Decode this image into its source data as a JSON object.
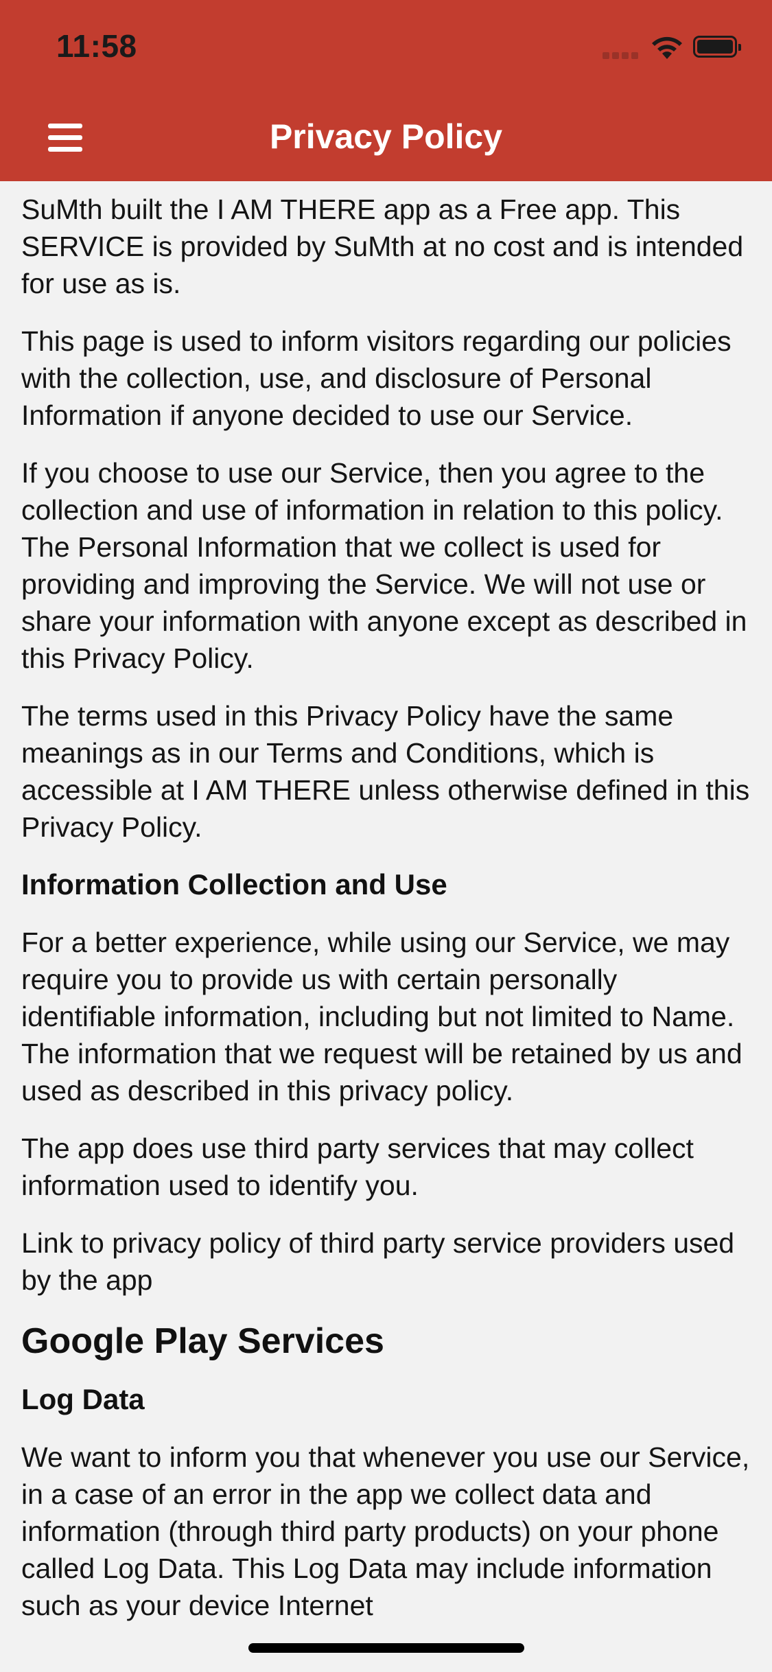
{
  "status_bar": {
    "time": "11:58",
    "icons": [
      "cellular-signal-icon",
      "wifi-icon",
      "battery-icon"
    ]
  },
  "nav": {
    "title": "Privacy Policy",
    "menu_icon": "hamburger-menu-icon"
  },
  "content": {
    "p1": "SuMth built the I AM THERE app as a Free app. This SERVICE is provided by SuMth at no cost and is intended for use as is.",
    "p2": "This page is used to inform visitors regarding our policies with the collection, use, and disclosure of Personal Information if anyone decided to use our Service.",
    "p3": "If you choose to use our Service, then you agree to the collection and use of information in relation to this policy. The Personal Information that we collect is used for providing and improving the Service. We will not use or share your information with anyone except as described in this Privacy Policy.",
    "p4": "The terms used in this Privacy Policy have the same meanings as in our Terms and Conditions, which is accessible at I AM THERE unless otherwise defined in this Privacy Policy.",
    "h_collection": "Information Collection and Use",
    "p5": "For a better experience, while using our Service, we may require you to provide us with certain personally identifiable information, including but not limited to Name. The information that we request will be retained by us and used as described in this privacy policy.",
    "p6": "The app does use third party services that may collect information used to identify you.",
    "p7": "Link to privacy policy of third party service providers used by the app",
    "h_google": "Google Play Services",
    "h_log": "Log Data",
    "p8": "We want to inform you that whenever you use our Service, in a case of an error in the app we collect data and information (through third party products) on your phone called Log Data. This Log Data may include information such as your device Internet"
  },
  "colors": {
    "brand": "#c23d2f",
    "background": "#f2f2f2",
    "text": "#141414"
  }
}
